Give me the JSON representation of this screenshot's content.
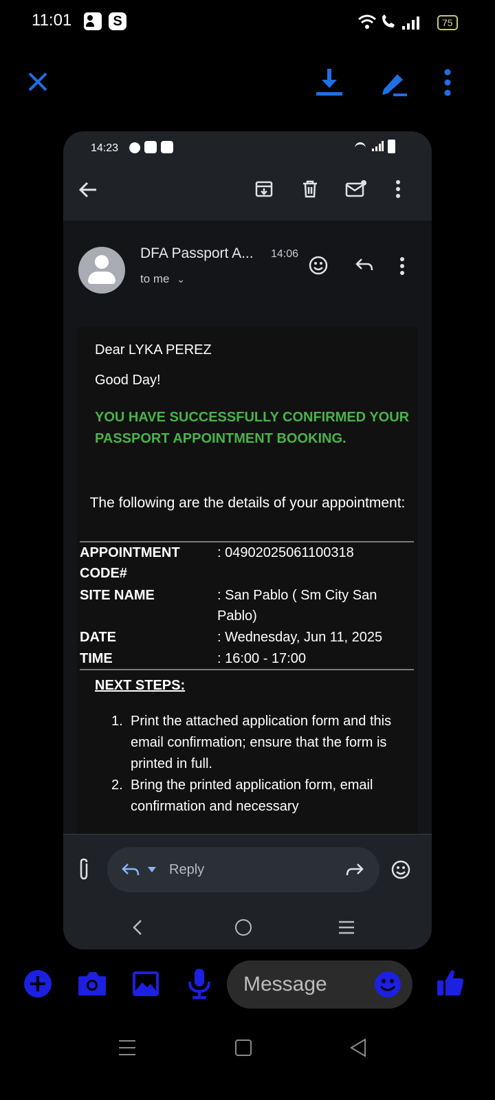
{
  "status_bar": {
    "time": "11:01",
    "battery": "75"
  },
  "phone_status": {
    "time": "14:23"
  },
  "email": {
    "sender": "DFA Passport A...",
    "time": "14:06",
    "recipient": "to me",
    "greeting": "Dear LYKA PEREZ",
    "good_day": "Good Day!",
    "confirmation": "YOU HAVE SUCCESSFULLY CONFIRMED YOUR PASSPORT APPOINTMENT BOOKING.",
    "intro": "The following are the details of your appointment:",
    "details": [
      {
        "label": "APPOINTMENT CODE#",
        "value": ": 04902025061100318"
      },
      {
        "label": "SITE NAME",
        "value": ": San Pablo ( Sm City San Pablo)"
      },
      {
        "label": "DATE",
        "value": ": Wednesday, Jun 11, 2025"
      },
      {
        "label": "TIME",
        "value": ": 16:00 - 17:00"
      }
    ],
    "next_steps_title": "NEXT STEPS:",
    "steps": [
      {
        "num": "1.",
        "text": "Print the attached application form and this email confirmation; ensure that the form is printed in full."
      },
      {
        "num": "2.",
        "text": "Bring the printed application form, email confirmation and necessary"
      }
    ]
  },
  "reply": {
    "label": "Reply"
  },
  "composer": {
    "placeholder": "Message"
  },
  "colors": {
    "accent_blue": "#1f6fe5",
    "deep_blue": "#1c20e0",
    "green_text": "#49b34a"
  }
}
